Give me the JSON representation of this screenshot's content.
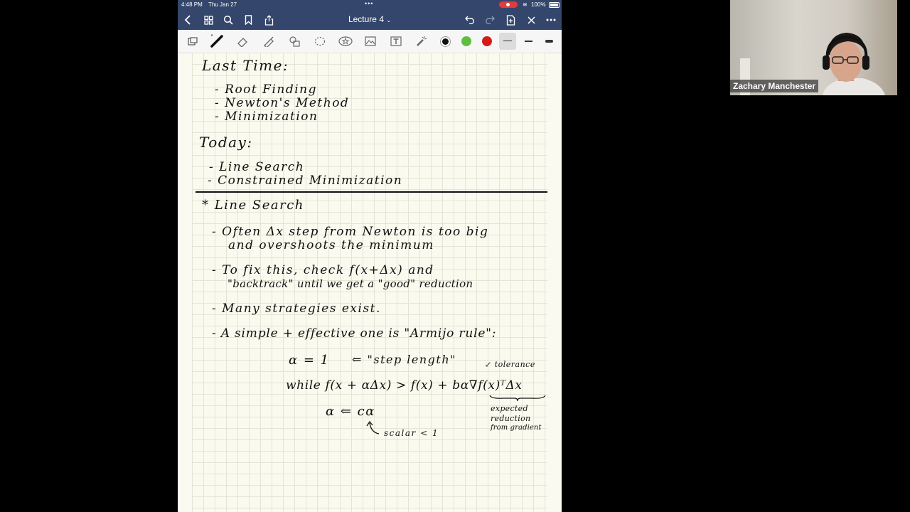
{
  "status": {
    "time": "4:48 PM",
    "date": "Thu Jan 27",
    "battery": "100%"
  },
  "document": {
    "title": "Lecture 4"
  },
  "toolbar": {
    "colors": [
      "#111111",
      "#5fbf3d",
      "#d61a1a"
    ],
    "tools": [
      "page-view-icon",
      "pen-icon",
      "eraser-icon",
      "highlighter-icon",
      "shapes-icon",
      "lasso-icon",
      "elements-icon",
      "image-icon",
      "text-icon",
      "laser-pointer-icon"
    ]
  },
  "notes": {
    "last_time_heading": "Last Time:",
    "last_time_items": [
      "- Root Finding",
      "- Newton's Method",
      "- Minimization"
    ],
    "today_heading": "Today:",
    "today_items": [
      "- Line Search",
      "- Constrained Minimization"
    ],
    "section_heading": "* Line Search",
    "bullets": [
      "- Often Δx step from Newton is too big",
      "and overshoots the minimum",
      "- To fix this, check f(x+Δx) and",
      "\"backtrack\" until we get a \"good\" reduction",
      "- Many strategies exist.",
      "- A simple + effective one is \"Armijo rule\":"
    ],
    "alpha_init": "α = 1",
    "step_length_note": "⇐ \"step length\"",
    "while_line": "while  f(x + αΔx) > f(x) + bα∇f(x)ᵀΔx",
    "tolerance_note": "↙ tolerance",
    "update_line": "α ⇐ cα",
    "scalar_note": "scalar < 1",
    "expected_note": [
      "expected",
      "reduction",
      "from gradient"
    ]
  },
  "participant": {
    "name": "Zachary Manchester"
  }
}
